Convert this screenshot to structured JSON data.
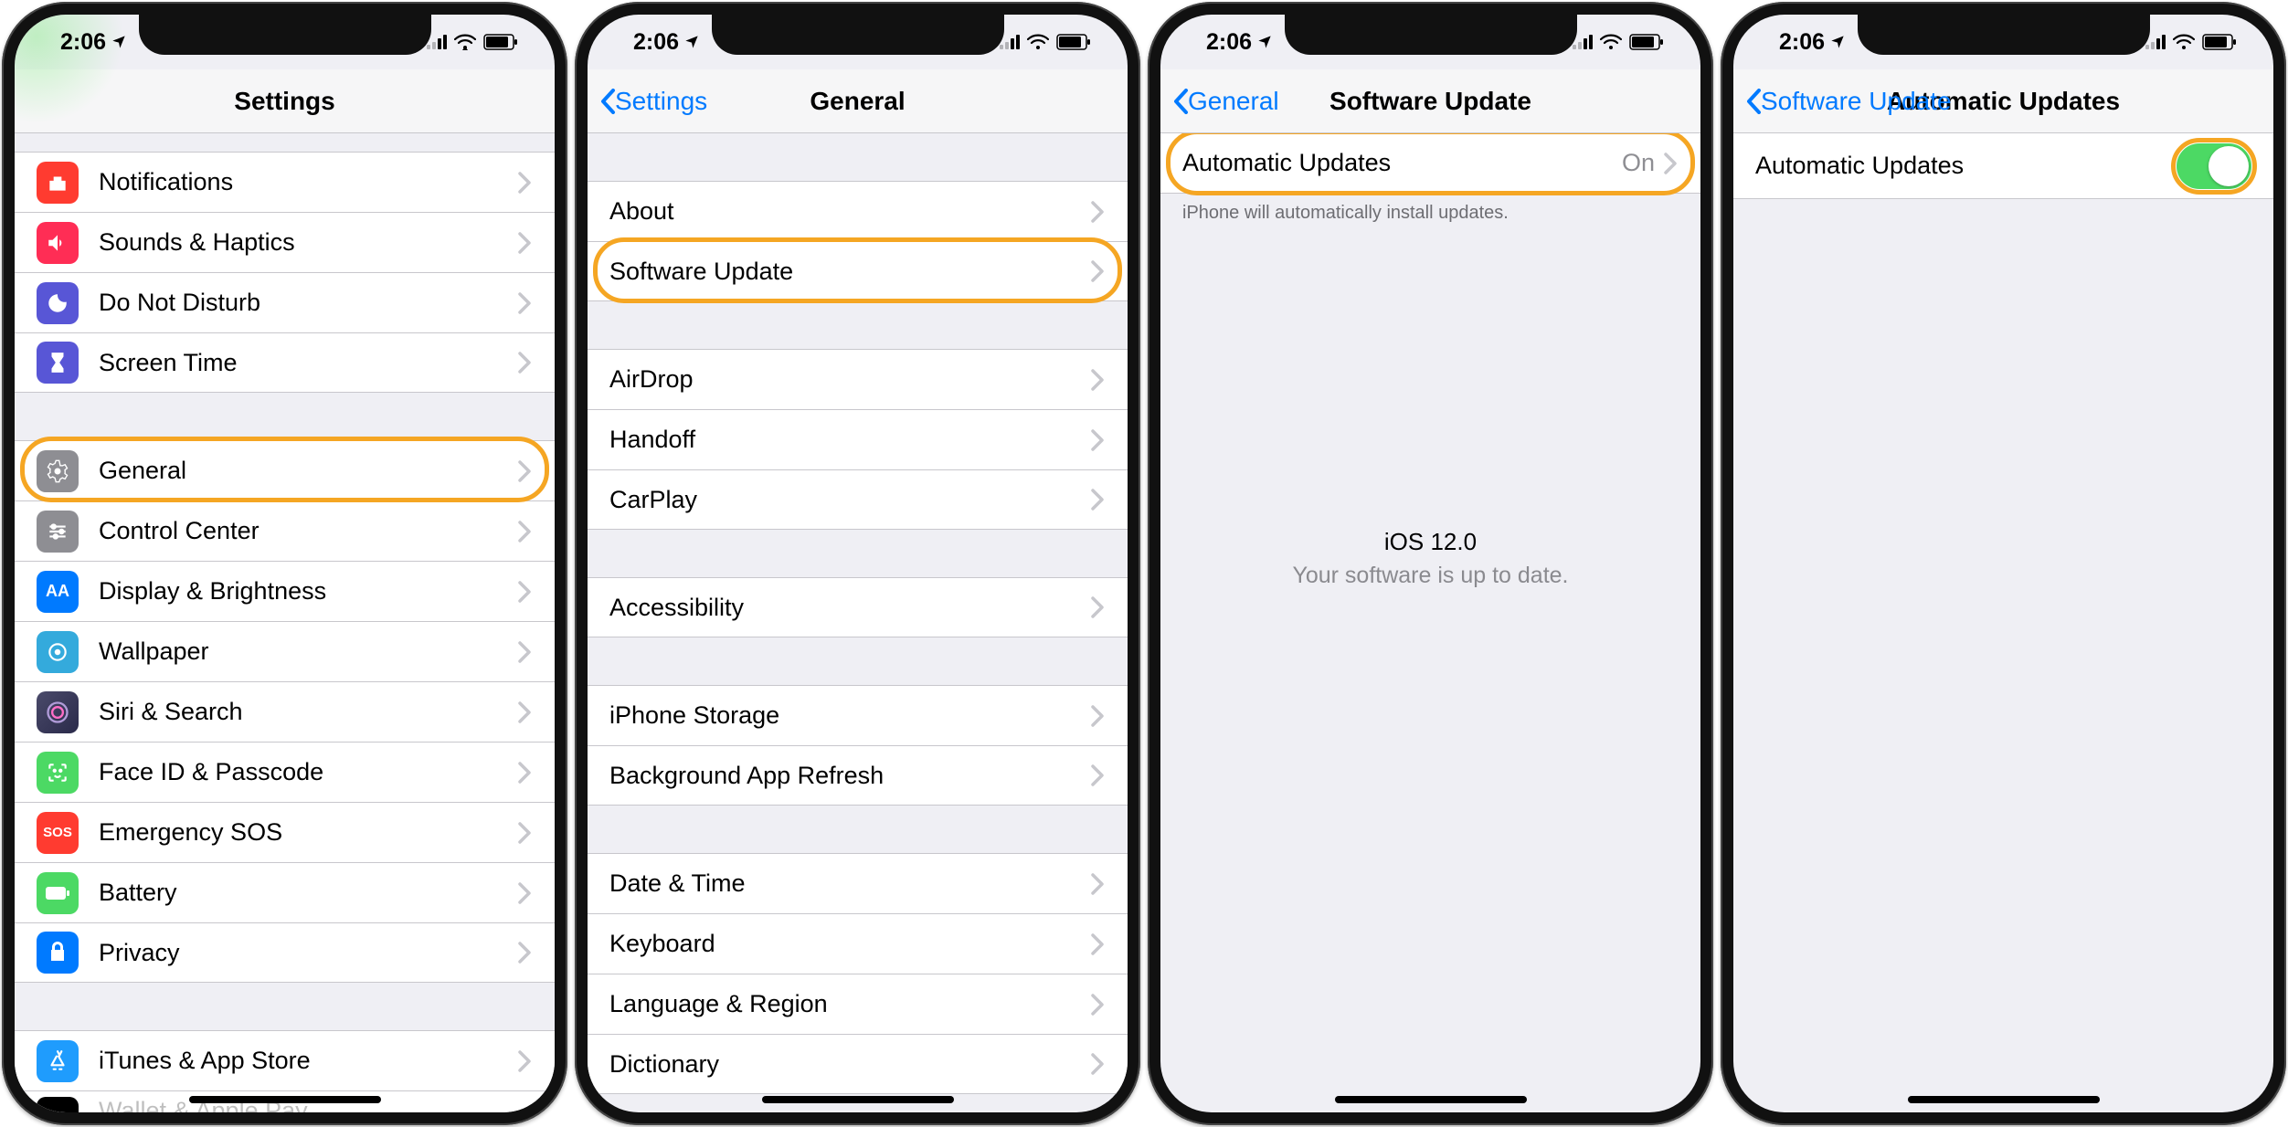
{
  "status": {
    "time": "2:06"
  },
  "screens": {
    "s1": {
      "title": "Settings",
      "rows": {
        "notifications": "Notifications",
        "sounds": "Sounds & Haptics",
        "dnd": "Do Not Disturb",
        "screentime": "Screen Time",
        "general": "General",
        "controlcenter": "Control Center",
        "display": "Display & Brightness",
        "wallpaper": "Wallpaper",
        "siri": "Siri & Search",
        "faceid": "Face ID & Passcode",
        "sos": "Emergency SOS",
        "battery": "Battery",
        "privacy": "Privacy",
        "itunes": "iTunes & App Store",
        "wallet": "Wallet & Apple Pay"
      }
    },
    "s2": {
      "back": "Settings",
      "title": "General",
      "rows": {
        "about": "About",
        "softwareupdate": "Software Update",
        "airdrop": "AirDrop",
        "handoff": "Handoff",
        "carplay": "CarPlay",
        "accessibility": "Accessibility",
        "storage": "iPhone Storage",
        "refresh": "Background App Refresh",
        "datetime": "Date & Time",
        "keyboard": "Keyboard",
        "language": "Language & Region",
        "dictionary": "Dictionary"
      }
    },
    "s3": {
      "back": "General",
      "title": "Software Update",
      "rowLabel": "Automatic Updates",
      "rowValue": "On",
      "footer": "iPhone will automatically install updates.",
      "version": "iOS 12.0",
      "message": "Your software is up to date."
    },
    "s4": {
      "back": "Software Update",
      "title": "Automatic Updates",
      "rowLabel": "Automatic Updates"
    }
  },
  "colors": {
    "red": "#ff3b30",
    "pink": "#ff2d55",
    "purple": "#5856d6",
    "hourglass": "#5856d6",
    "gray": "#8e8e93",
    "darkgray": "#8e8e93",
    "blue": "#007aff",
    "cyan": "#34aadc",
    "green": "#4cd964",
    "greenbright": "#4cd964",
    "appstore": "#1f9cfd"
  }
}
